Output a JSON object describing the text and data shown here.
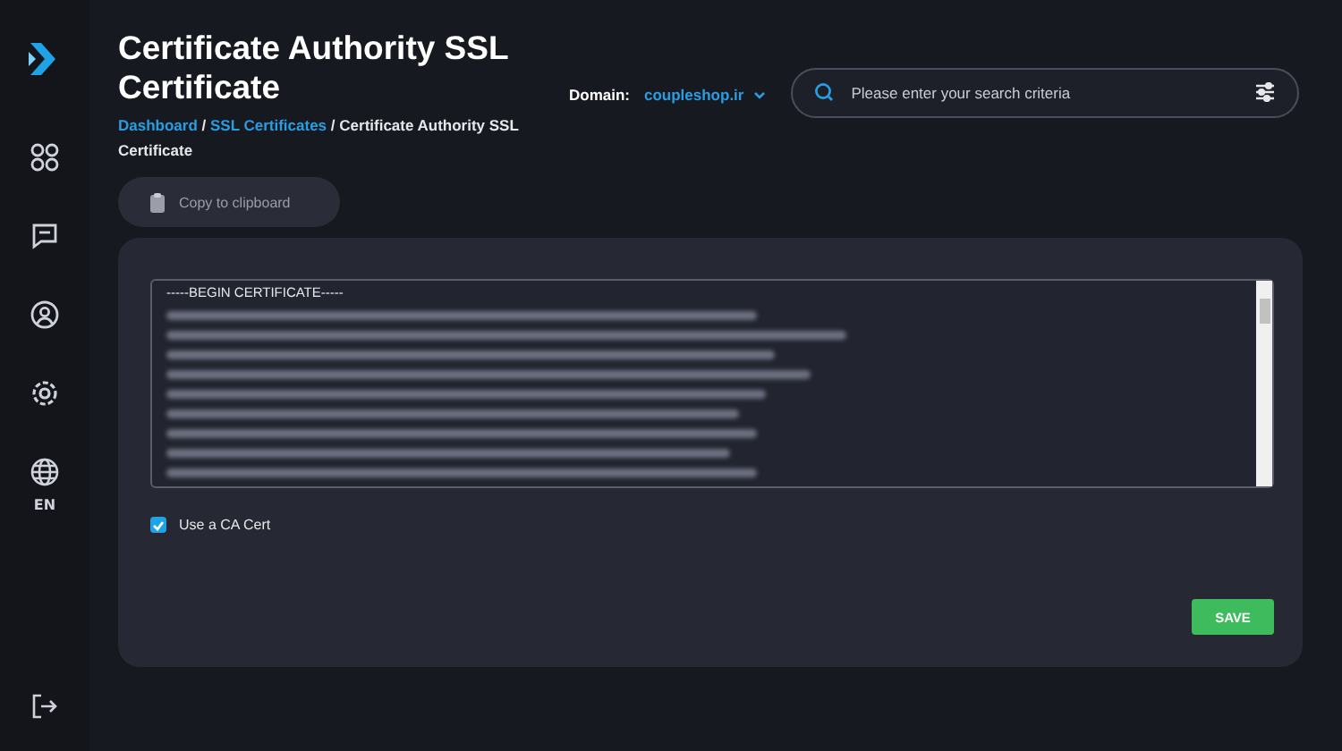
{
  "sidebar": {
    "items": [
      {
        "kind": "apps"
      },
      {
        "kind": "messages"
      },
      {
        "kind": "profile"
      },
      {
        "kind": "settings"
      },
      {
        "kind": "language",
        "label": "EN"
      }
    ]
  },
  "header": {
    "title": "Certificate Authority SSL Certificate",
    "breadcrumb_separator": "/",
    "breadcrumb": [
      {
        "label": "Dashboard",
        "link": true
      },
      {
        "label": "SSL Certificates",
        "link": true
      },
      {
        "label": "Certificate Authority SSL Certificate",
        "link": false
      }
    ],
    "domain_label": "Domain:",
    "domain": "coupleshop.ir"
  },
  "search": {
    "placeholder": "Please enter your search criteria"
  },
  "copy_button": "Copy to clipboard",
  "certificate": {
    "first_line": "-----BEGIN CERTIFICATE-----"
  },
  "ca_cert": {
    "label": "Use a CA Cert",
    "checked": true
  },
  "save_button": "SAVE"
}
